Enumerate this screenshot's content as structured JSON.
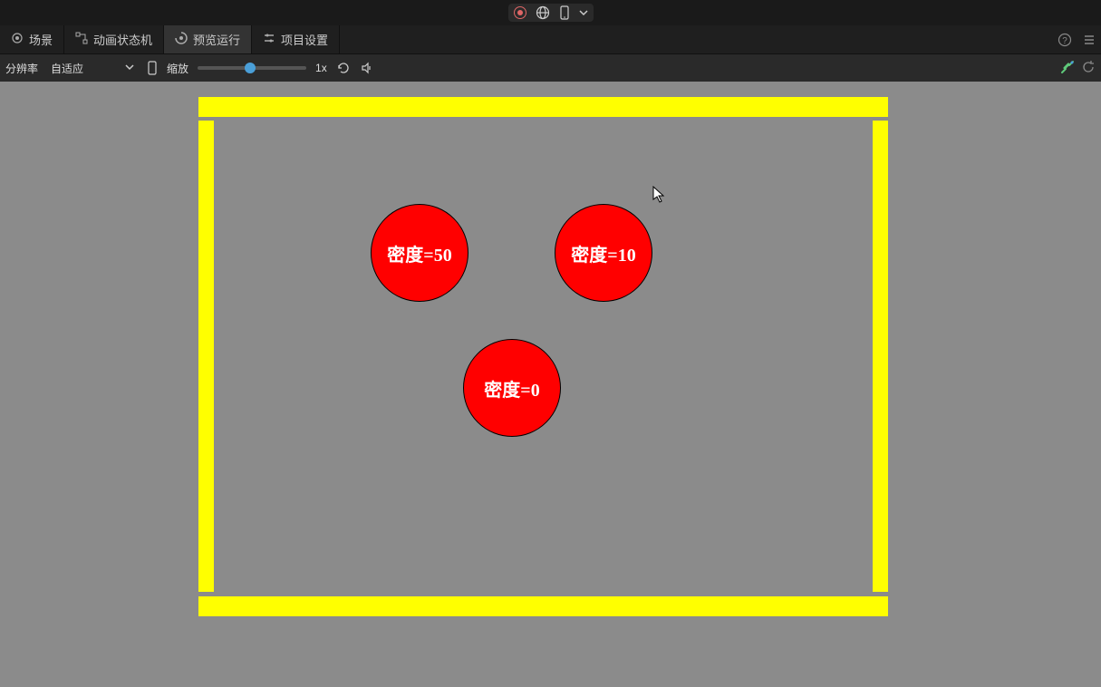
{
  "topbar": {
    "record": "record",
    "globe": "globe",
    "device": "device",
    "dropdown": "dropdown"
  },
  "tabs": {
    "scene": "场景",
    "animation": "动画状态机",
    "preview": "预览运行",
    "settings": "项目设置"
  },
  "toolbar": {
    "resolution_label": "分辨率",
    "resolution_value": "自适应",
    "zoom_label": "缩放",
    "zoom_value": "1x"
  },
  "stage": {
    "balls": [
      {
        "label": "密度=50"
      },
      {
        "label": "密度=10"
      },
      {
        "label": "密度=0"
      }
    ]
  }
}
